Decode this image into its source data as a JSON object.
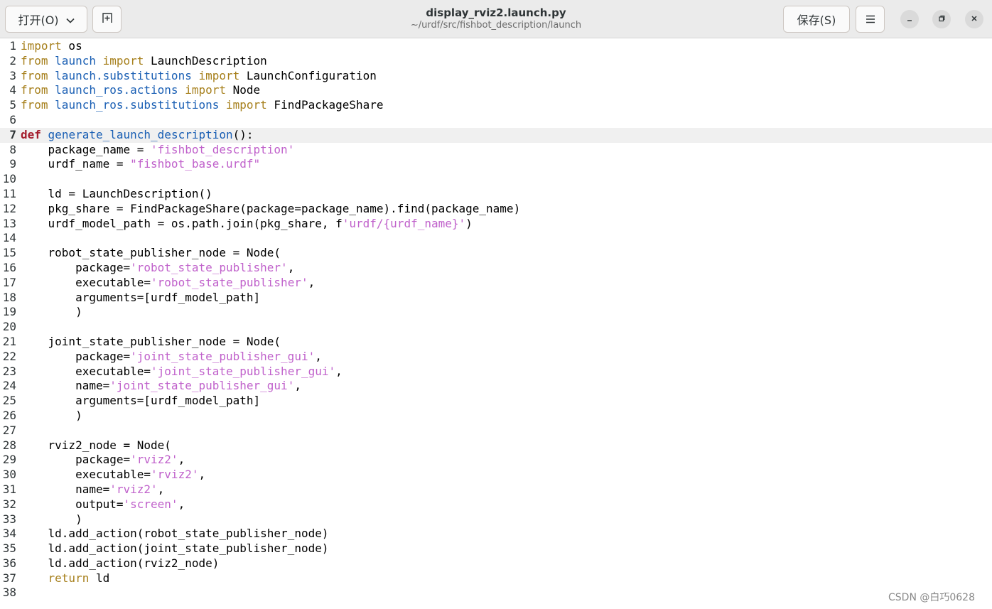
{
  "header": {
    "open_label": "打开(O)",
    "title": "display_rviz2.launch.py",
    "subtitle": "~/urdf/src/fishbot_description/launch",
    "save_label": "保存(S)"
  },
  "icons": {
    "open_dropdown": "chevron-down-icon",
    "new_tab": "new-tab-icon",
    "menu": "hamburger-menu-icon",
    "minimize": "minimize-icon",
    "maximize": "restore-icon",
    "close": "close-icon"
  },
  "editor": {
    "current_line": 7,
    "lines": [
      "1",
      "2",
      "3",
      "4",
      "5",
      "6",
      "7",
      "8",
      "9",
      "10",
      "11",
      "12",
      "13",
      "14",
      "15",
      "16",
      "17",
      "18",
      "19",
      "20",
      "21",
      "22",
      "23",
      "24",
      "25",
      "26",
      "27",
      "28",
      "29",
      "30",
      "31",
      "32",
      "33",
      "34",
      "35",
      "36",
      "37",
      "38"
    ],
    "code": [
      [
        [
          "kw",
          "import"
        ],
        [
          "t",
          " os"
        ]
      ],
      [
        [
          "kw",
          "from"
        ],
        [
          "t",
          " "
        ],
        [
          "mod",
          "launch"
        ],
        [
          "t",
          " "
        ],
        [
          "kw",
          "import"
        ],
        [
          "t",
          " LaunchDescription"
        ]
      ],
      [
        [
          "kw",
          "from"
        ],
        [
          "t",
          " "
        ],
        [
          "mod",
          "launch.substitutions"
        ],
        [
          "t",
          " "
        ],
        [
          "kw",
          "import"
        ],
        [
          "t",
          " LaunchConfiguration"
        ]
      ],
      [
        [
          "kw",
          "from"
        ],
        [
          "t",
          " "
        ],
        [
          "mod",
          "launch_ros.actions"
        ],
        [
          "t",
          " "
        ],
        [
          "kw",
          "import"
        ],
        [
          "t",
          " Node"
        ]
      ],
      [
        [
          "kw",
          "from"
        ],
        [
          "t",
          " "
        ],
        [
          "mod",
          "launch_ros.substitutions"
        ],
        [
          "t",
          " "
        ],
        [
          "kw",
          "import"
        ],
        [
          "t",
          " FindPackageShare"
        ]
      ],
      [],
      [
        [
          "kw-def",
          "def"
        ],
        [
          "t",
          " "
        ],
        [
          "fn",
          "generate_launch_description"
        ],
        [
          "t",
          "():"
        ]
      ],
      [
        [
          "t",
          "    package_name = "
        ],
        [
          "str",
          "'fishbot_description'"
        ]
      ],
      [
        [
          "t",
          "    urdf_name = "
        ],
        [
          "str",
          "\"fishbot_base.urdf\""
        ]
      ],
      [],
      [
        [
          "t",
          "    ld = LaunchDescription()"
        ]
      ],
      [
        [
          "t",
          "    pkg_share = FindPackageShare(package=package_name).find(package_name)"
        ]
      ],
      [
        [
          "t",
          "    urdf_model_path = os.path.join(pkg_share, f"
        ],
        [
          "str",
          "'urdf/{urdf_name}'"
        ],
        [
          "t",
          ")"
        ]
      ],
      [],
      [
        [
          "t",
          "    robot_state_publisher_node = Node("
        ]
      ],
      [
        [
          "t",
          "        package="
        ],
        [
          "str",
          "'robot_state_publisher'"
        ],
        [
          "t",
          ","
        ]
      ],
      [
        [
          "t",
          "        executable="
        ],
        [
          "str",
          "'robot_state_publisher'"
        ],
        [
          "t",
          ","
        ]
      ],
      [
        [
          "t",
          "        arguments=[urdf_model_path]"
        ]
      ],
      [
        [
          "t",
          "        )"
        ]
      ],
      [],
      [
        [
          "t",
          "    joint_state_publisher_node = Node("
        ]
      ],
      [
        [
          "t",
          "        package="
        ],
        [
          "str",
          "'joint_state_publisher_gui'"
        ],
        [
          "t",
          ","
        ]
      ],
      [
        [
          "t",
          "        executable="
        ],
        [
          "str",
          "'joint_state_publisher_gui'"
        ],
        [
          "t",
          ","
        ]
      ],
      [
        [
          "t",
          "        name="
        ],
        [
          "str",
          "'joint_state_publisher_gui'"
        ],
        [
          "t",
          ","
        ]
      ],
      [
        [
          "t",
          "        arguments=[urdf_model_path]"
        ]
      ],
      [
        [
          "t",
          "        )"
        ]
      ],
      [],
      [
        [
          "t",
          "    rviz2_node = Node("
        ]
      ],
      [
        [
          "t",
          "        package="
        ],
        [
          "str",
          "'rviz2'"
        ],
        [
          "t",
          ","
        ]
      ],
      [
        [
          "t",
          "        executable="
        ],
        [
          "str",
          "'rviz2'"
        ],
        [
          "t",
          ","
        ]
      ],
      [
        [
          "t",
          "        name="
        ],
        [
          "str",
          "'rviz2'"
        ],
        [
          "t",
          ","
        ]
      ],
      [
        [
          "t",
          "        output="
        ],
        [
          "str",
          "'screen'"
        ],
        [
          "t",
          ","
        ]
      ],
      [
        [
          "t",
          "        )"
        ]
      ],
      [
        [
          "t",
          "    ld.add_action(robot_state_publisher_node)"
        ]
      ],
      [
        [
          "t",
          "    ld.add_action(joint_state_publisher_node)"
        ]
      ],
      [
        [
          "t",
          "    ld.add_action(rviz2_node)"
        ]
      ],
      [
        [
          "t",
          "    "
        ],
        [
          "kw",
          "return"
        ],
        [
          "t",
          " ld"
        ]
      ],
      []
    ]
  },
  "watermark": "CSDN @白巧0628",
  "colors": {
    "keyword": "#a67f1b",
    "def_keyword": "#a51d2d",
    "module_and_function": "#1a5fb4",
    "string": "#c061cb",
    "current_line_bg": "#f0f0f0"
  }
}
